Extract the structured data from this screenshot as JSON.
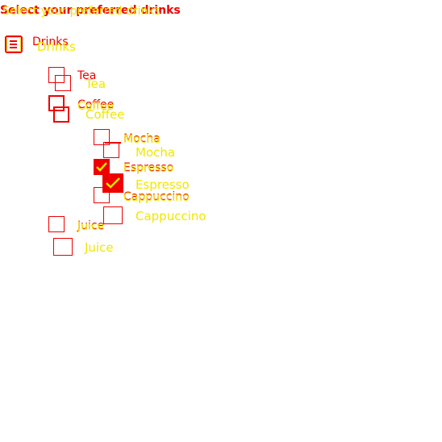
{
  "colors": {
    "red": "#ee0000",
    "yellow": "#f2e600",
    "white": "#ffffff"
  },
  "title": {
    "main": "Select your preferred drinks",
    "ghost": "Select your preferred drinks"
  },
  "root": {
    "label": "Drinks",
    "icon": "list-checkbox-icon"
  },
  "items": {
    "tea": {
      "label": "Tea",
      "checked": false
    },
    "coffee": {
      "label": "Coffee",
      "checked": false,
      "indeterminate": true
    },
    "mocha": {
      "label": "Mocha",
      "checked": false
    },
    "espresso": {
      "label": "Espresso",
      "checked": true
    },
    "cappuccino": {
      "label": "Cappuccino",
      "checked": false
    },
    "juice": {
      "label": "Juice",
      "checked": false
    }
  }
}
